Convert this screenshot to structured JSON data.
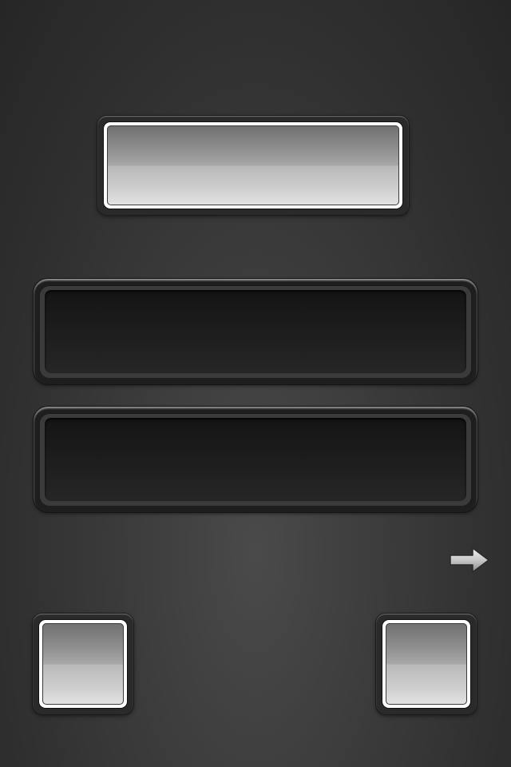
{
  "top_button": {
    "label": ""
  },
  "field_1": {
    "value": "",
    "placeholder": ""
  },
  "field_2": {
    "value": "",
    "placeholder": ""
  },
  "next_arrow": {
    "icon": "right-arrow-icon"
  },
  "bottom_left_button": {
    "label": ""
  },
  "bottom_right_button": {
    "label": ""
  },
  "colors": {
    "background": "#3a3a3a",
    "field_well": "#1a1a1a",
    "button_face": "#b0b0b0"
  }
}
